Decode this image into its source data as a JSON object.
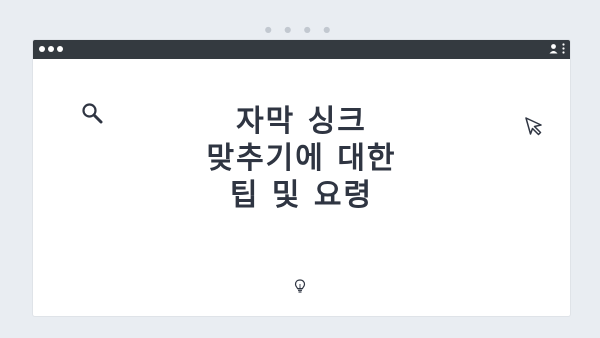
{
  "browser": {
    "window_controls": [
      "close",
      "minimize",
      "maximize"
    ],
    "top_indicator_dots": 4,
    "icons": {
      "profile": "profile-icon",
      "menu": "kebab-menu-icon"
    },
    "colors": {
      "background": "#e9edf2",
      "titlebar": "#343a40",
      "content": "#ffffff",
      "text": "#2f3542"
    }
  },
  "main": {
    "title_lines": [
      "자막 싱크",
      "맞추기에 대한",
      "팁 및 요령"
    ],
    "icons": {
      "search": "search-icon",
      "cursor": "cursor-arrow-icon",
      "bulb": "lightbulb-icon"
    }
  }
}
